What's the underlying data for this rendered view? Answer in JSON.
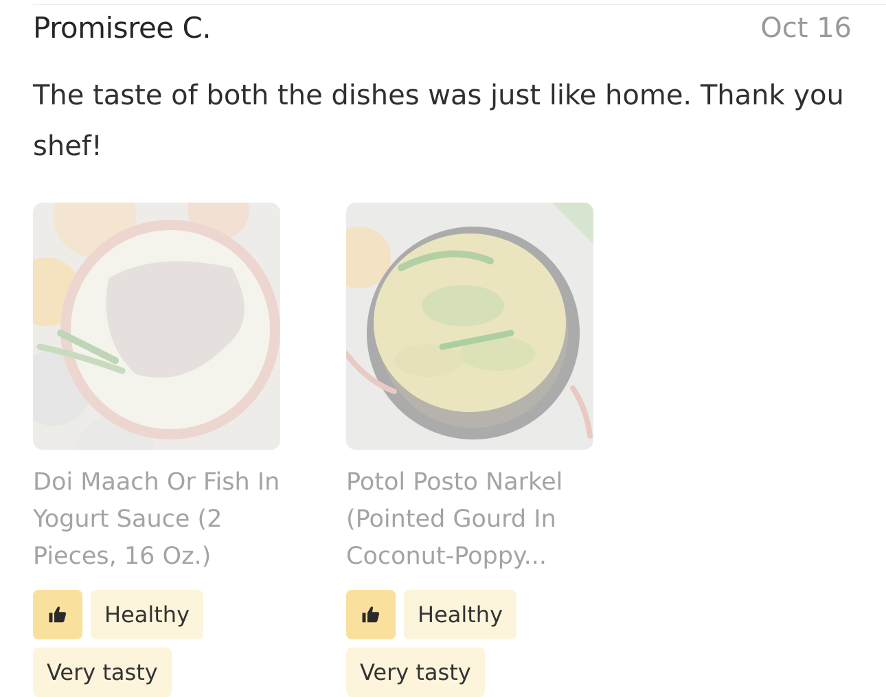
{
  "review": {
    "reviewer_name": "Promisree C.",
    "date": "Oct 16",
    "text": "The taste of both the dishes was just like home. Thank you shef!"
  },
  "dishes": [
    {
      "name": "Doi Maach Or Fish In Yogurt Sauce (2 Pieces, 16 Oz.)",
      "photo_icon": "fish-curry-photo",
      "tags": [
        "Healthy",
        "Very tasty"
      ],
      "thumb_icon": "thumbs-up-icon"
    },
    {
      "name": "Potol Posto Narkel (Pointed Gourd In Coconut-Poppy...",
      "photo_icon": "gourd-curry-photo",
      "tags": [
        "Healthy",
        "Very tasty"
      ],
      "thumb_icon": "thumbs-up-icon"
    }
  ],
  "colors": {
    "tag_background": "#fdf4dc",
    "thumb_background": "#f9e09c",
    "muted_text": "#a4a4a4"
  }
}
